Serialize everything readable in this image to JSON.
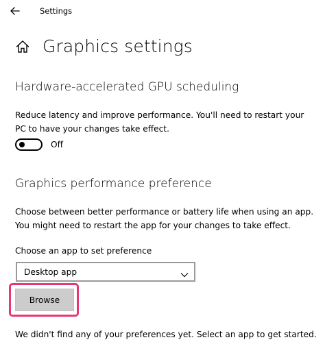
{
  "window": {
    "back_icon": "arrow-left-icon",
    "app_title": "Settings"
  },
  "page": {
    "home_icon": "home-icon",
    "title": "Graphics settings"
  },
  "gpu_scheduling": {
    "heading": "Hardware-accelerated GPU scheduling",
    "description": "Reduce latency and improve performance. You'll need to restart your PC to have your changes take effect.",
    "toggle_state": "Off"
  },
  "performance_preference": {
    "heading": "Graphics performance preference",
    "description": "Choose between better performance or battery life when using an app. You might need to restart the app for your changes to take effect.",
    "select_label": "Choose an app to set preference",
    "selected_app": "Desktop app",
    "browse_label": "Browse",
    "empty_message": "We didn't find any of your preferences yet. Select an app to get started."
  },
  "colors": {
    "highlight": "#e6396f",
    "button_bg": "#cccccc",
    "select_border": "#999999"
  }
}
